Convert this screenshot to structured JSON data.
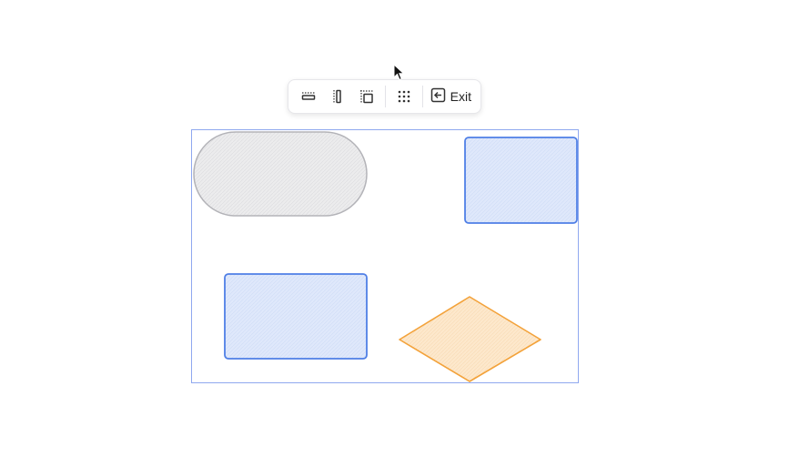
{
  "toolbar": {
    "items": [
      {
        "name": "align-horizontal-icon",
        "label": ""
      },
      {
        "name": "align-vertical-icon",
        "label": ""
      },
      {
        "name": "align-center-icon",
        "label": ""
      },
      {
        "name": "grid-icon",
        "label": ""
      }
    ],
    "exit_label": "Exit"
  },
  "colors": {
    "selection": "#8fa8ef",
    "stadium_fill": "#e9e9ea",
    "stadium_stroke": "#b3b3b8",
    "rect_fill": "#dde7fa",
    "rect_stroke": "#4f7fe6",
    "diamond_fill": "#fde6c8",
    "diamond_stroke": "#f3a23a"
  }
}
